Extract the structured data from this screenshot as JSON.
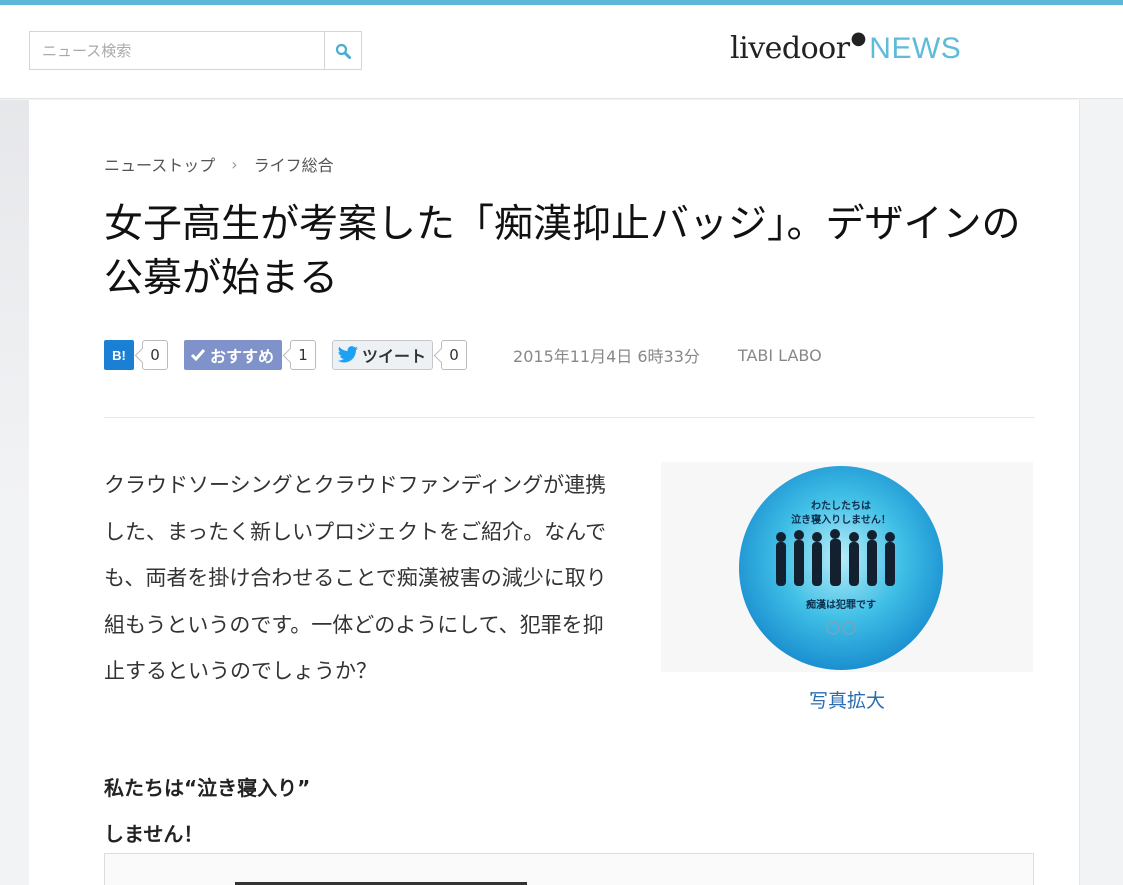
{
  "search": {
    "placeholder": "ニュース検索"
  },
  "logo": {
    "main": "livedoor",
    "news": "NEWS"
  },
  "breadcrumb": {
    "items": [
      "ニューストップ",
      "ライフ総合"
    ],
    "separator": "›"
  },
  "article": {
    "title": "女子高生が考案した「痴漢抑止バッジ」。デザインの公募が始まる",
    "date": "2015年11月4日 6時33分",
    "source": "TABI LABO",
    "body": "クラウドソーシングとクラウドファンディングが連携した、まったく新しいプロジェクトをご紹介。なんでも、両者を掛け合わせることで痴漢被害の減少に取り組もうというのです。一体どのようにして、犯罪を抑止するというのでしょうか？",
    "subhead_line1": "私たちは“泣き寝入り”",
    "subhead_line2": "しません！"
  },
  "social": {
    "hatena": {
      "label": "B!",
      "count": "0"
    },
    "osusume": {
      "label": "おすすめ",
      "count": "1"
    },
    "tweet": {
      "label": "ツイート",
      "count": "0"
    }
  },
  "photo": {
    "badge_line1": "わたしたちは",
    "badge_line2": "泣き寝入りしません！",
    "badge_line3": "痴漢は犯罪です",
    "enlarge_label": "写真拡大"
  },
  "colors": {
    "accent": "#5db8d7",
    "hatena": "#1b7fd3",
    "osusume": "#7f92c9",
    "link": "#2a6db0"
  },
  "icons": {
    "search": "search-icon",
    "check": "check-icon",
    "twitter": "twitter-bird-icon"
  }
}
